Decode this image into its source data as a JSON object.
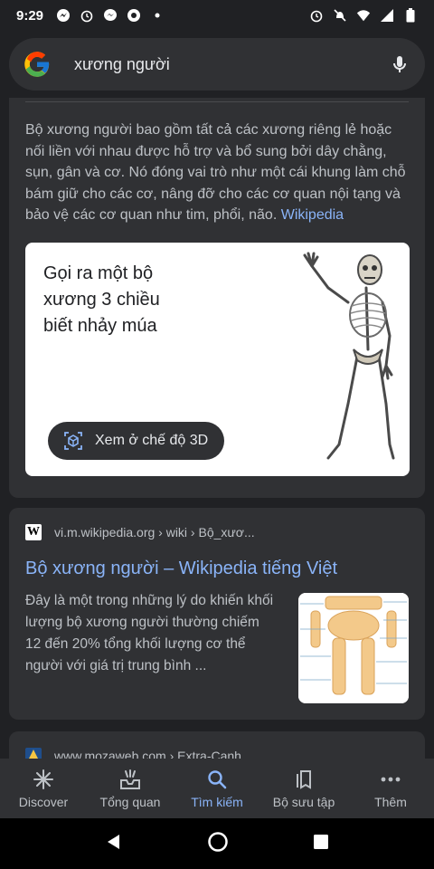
{
  "status_bar": {
    "time": "9:29"
  },
  "search": {
    "query": "xương người"
  },
  "knowledge_panel": {
    "description": "Bộ xương người bao gồm tất cả các xương riêng lẻ hoặc nối liền với nhau được hỗ trợ và bổ sung bởi dây chằng, sụn, gân và cơ. Nó đóng vai trò như một cái khung làm chỗ bám giữ cho các cơ, nâng đỡ cho các cơ quan nội tạng và bảo vệ các cơ quan như tim, phổi, não.",
    "source_link": "Wikipedia",
    "skeleton_card": {
      "title": "Gọi ra một bộ xương 3 chiều biết nhảy múa",
      "button_label": "Xem ở chế độ 3D"
    }
  },
  "results": [
    {
      "url": "vi.m.wikipedia.org › wiki › Bộ_xươ...",
      "title": "Bộ xương người – Wikipedia tiếng Việt",
      "snippet": "Đây là một trong những lý do khiến khối lượng bộ xương người thường chiếm 12 đến 20% tổng khối lượng cơ thể người với giá trị trung bình ..."
    },
    {
      "url": "www.mozaweb.com › Extra-Canh"
    }
  ],
  "bottom_nav": [
    {
      "label": "Discover",
      "icon": "asterisk-icon"
    },
    {
      "label": "Tổng quan",
      "icon": "inbox-icon"
    },
    {
      "label": "Tìm kiếm",
      "icon": "search-icon",
      "active": true
    },
    {
      "label": "Bộ sưu tập",
      "icon": "collections-icon"
    },
    {
      "label": "Thêm",
      "icon": "more-icon"
    }
  ],
  "colors": {
    "background": "#202124",
    "card": "#303134",
    "link": "#8ab4f8",
    "text": "#bdc1c6"
  }
}
